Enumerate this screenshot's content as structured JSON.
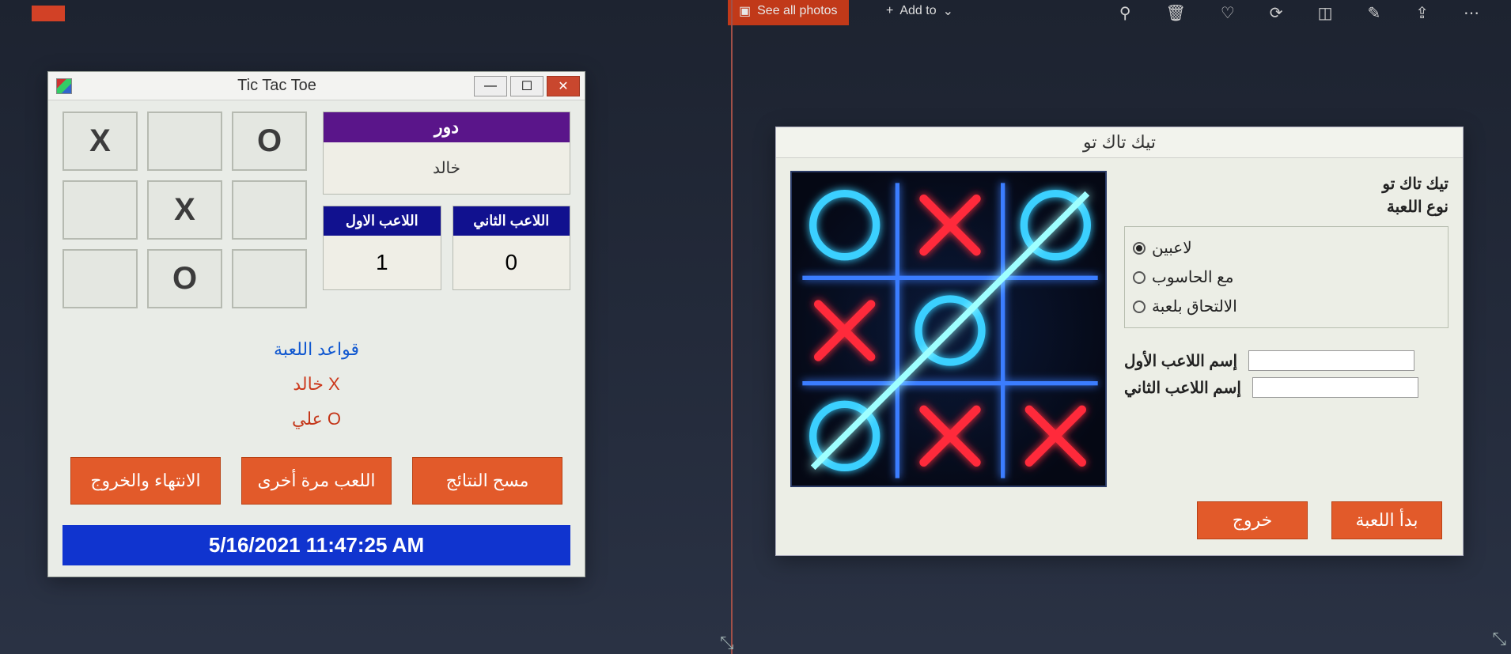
{
  "photos": {
    "see_all": "See all photos",
    "add_to": "Add to",
    "tools": [
      "zoom",
      "delete",
      "favorite",
      "rotate",
      "crop",
      "draw",
      "share",
      "more"
    ]
  },
  "leftWindow": {
    "title": "Tic Tac Toe",
    "board": [
      "X",
      "",
      "O",
      "",
      "X",
      "",
      "",
      "O",
      ""
    ],
    "turn_header": "دور",
    "turn_player": "خالد",
    "score": {
      "p1_label": "اللاعب الاول",
      "p2_label": "اللاعب الثاني",
      "p1_value": "1",
      "p2_value": "0"
    },
    "rules_link": "قواعد اللعبة",
    "player_x": "خالد X",
    "player_o": "علي O",
    "buttons": {
      "finish_exit": "الانتهاء والخروج",
      "play_again": "اللعب مرة أخرى",
      "clear_results": "مسح النتائج"
    },
    "timestamp": "5/16/2021 11:47:25 AM"
  },
  "rightWindow": {
    "title": "تيك تاك تو",
    "header1": "تيك تاك تو",
    "header2": "نوع اللعبة",
    "radios": {
      "two_players": "لاعبين",
      "vs_computer": "مع الحاسوب",
      "join_game": "الالتحاق بلعبة"
    },
    "selected_radio": "two_players",
    "labels": {
      "p1": "إسم اللاعب الأول",
      "p2": "إسم اللاعب الثاني"
    },
    "inputs": {
      "p1": "",
      "p2": ""
    },
    "buttons": {
      "exit": "خروج",
      "start": "بدأ اللعبة"
    }
  }
}
